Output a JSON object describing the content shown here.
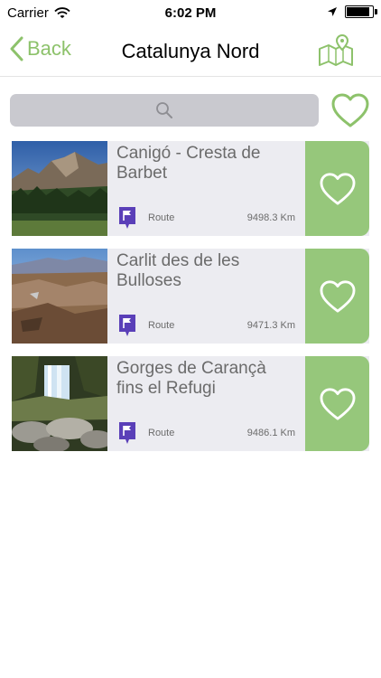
{
  "status_bar": {
    "carrier": "Carrier",
    "time": "6:02 PM",
    "battery_level": 0.98
  },
  "nav": {
    "back_label": "Back",
    "title": "Catalunya Nord"
  },
  "search": {
    "placeholder": ""
  },
  "colors": {
    "accent": "#8dc26b",
    "fav_button_bg": "#96c77b",
    "card_bg": "#ececf1",
    "route_badge": "#5a3fb8"
  },
  "routes": [
    {
      "title": "Canigó - Cresta de Barbet",
      "type": "Route",
      "distance": "9498.3 Km",
      "favorite": false
    },
    {
      "title": "Carlit des de les Bulloses",
      "type": "Route",
      "distance": "9471.3 Km",
      "favorite": false
    },
    {
      "title": "Gorges de Carançà fins el Refugi",
      "type": "Route",
      "distance": "9486.1 Km",
      "favorite": false
    }
  ]
}
